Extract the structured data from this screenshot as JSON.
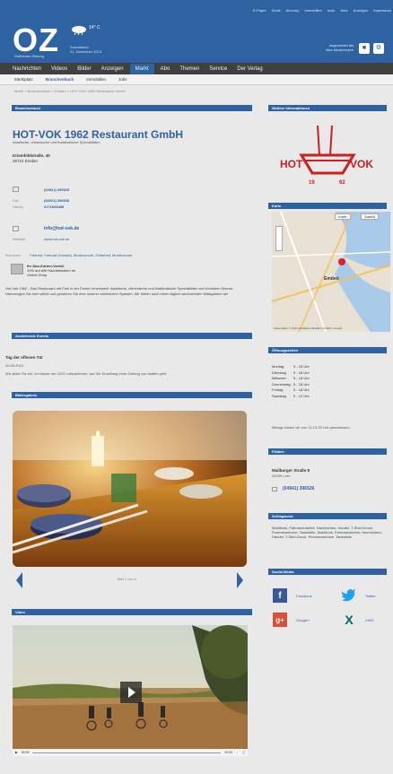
{
  "header": {
    "top_links": [
      "E-Paper",
      "Kiosk",
      "Abocorp",
      "Immobilien",
      "Auto",
      "Jobs",
      "Anzeigen",
      "Impressum"
    ],
    "logo": "OZ",
    "logo_sub": "Ostfriesen-Zeitung",
    "temperature": "14° C",
    "weekday": "Sonnabend",
    "date": "21. Dezember 2013",
    "login_label": "angemeldet als",
    "user_name": "Max Mustermann"
  },
  "main_nav": [
    "Nachrichten",
    "Videos",
    "Bilder",
    "Anzeigen",
    "Markt",
    "Abo",
    "Themen",
    "Service",
    "Der Verlag"
  ],
  "sub_nav": [
    "Marktplatz",
    "Branchenbuch",
    "Immobilien",
    "Jobs"
  ],
  "breadcrumb": "Markt > Branchenbuch > Emden > HOT-VOK 1962 Restaurant GmbH",
  "branchenbuch": {
    "heading": "Branchenbuch",
    "title": "HOT-VOK 1962 Restaurant GmbH",
    "subtitle": "Asiatische, chinesische und thailändische Spezialitäten",
    "street": "Kriemhildstraße, 40",
    "city": "26721 Emden",
    "phone_value": "(04921) 396525",
    "fax_label": "Fax",
    "fax_value": "(04921) 396536",
    "handy_label": "Handy",
    "handy_value": "0171668488",
    "email_value": "info@hot-vok.de",
    "website_label": "Website",
    "website_value": "www.hot-vok.de",
    "branchen_label": "Branchen",
    "branchen_value": "Fahrrad, Fahrrad (Handel), Musikschule, Zeitarbeit, Musikschule",
    "promo_title": "Ihr Abo-Karten-Vorteil",
    "promo_line1": "10% auf alle Handelswaren im",
    "promo_line2": "Online-Shop",
    "description": "Hot-Vok 1962 - Das Restaurant mit Flair in der Emder Innenstadt. Asiatische, chinesische und thailändische Spezialitäten auf höchstem Niveau. Überzeugen Sie sich selbst und genießen Sie eine unserer zahlreichen Speisen. Wir bieten auch einen täglich wechselnden Mittagstisch an!"
  },
  "events": {
    "heading": "Anstehende Events",
    "title": "Tag der offenen Tür",
    "date": "20.05.2013",
    "text": "Wir laden Sie ein, im Hause der OZ/O mitzuerleben, wie Die Erstellung einer Zeitung von statten geht."
  },
  "gallery": {
    "heading": "Bildergalerie",
    "caption": "Bild 1 von 4"
  },
  "video": {
    "heading": "Video",
    "time_left": "00:00",
    "time_right": "00:00"
  },
  "sidebar": {
    "info_heading": "Weitere Informationen",
    "logo_text_left": "HOT",
    "logo_text_right": "VOK",
    "logo_year_left": "19",
    "logo_year_right": "62",
    "map_heading": "Karte",
    "map_btn_karte": "Karte",
    "map_btn_satellit": "Satellit",
    "map_city": "Emden",
    "map_footer": "Kartendaten © 2013 GeoBasis-DE/BKG (©2009), Google",
    "hours_heading": "Öffnungszeiten",
    "hours": [
      {
        "day": "Montag",
        "time": "9 - 18 Uhr"
      },
      {
        "day": "Dienstag",
        "time": "9 - 18 Uhr"
      },
      {
        "day": "Mittwoch",
        "time": "9 - 18 Uhr"
      },
      {
        "day": "Donnerstag",
        "time": "9 - 18 Uhr"
      },
      {
        "day": "Freitag",
        "time": "9 - 18 Uhr"
      },
      {
        "day": "Samstag",
        "time": "9 - 12 Uhr"
      }
    ],
    "hours_note": "Mittags haben wir von 13-13.30 Uhr geschlossen.",
    "branches_heading": "Filialen",
    "branch_name": "Mailburger Straße 8",
    "branch_city": "26789 Leer",
    "branch_phone": "(04941) 396526",
    "keywords_heading": "Schlagworte",
    "keywords": "Mobilfunk, Fahrradzubehör, Nachrichten, Handel, T-Shirt-Druck, Pommesservice, Tankstelle, Mobilfunk, Fahrradzubehör, Nachrichten, Handel, T-Shirt-Druck, Pommesservice, Tankstelle",
    "social_heading": "Social-Media",
    "facebook": "Facebook",
    "twitter": "Twitter",
    "google": "Google+",
    "xing": "XING"
  },
  "colors": {
    "brand_blue": "#2f62a1",
    "nav_dark": "#404040",
    "logo_red": "#cc1f1f"
  }
}
